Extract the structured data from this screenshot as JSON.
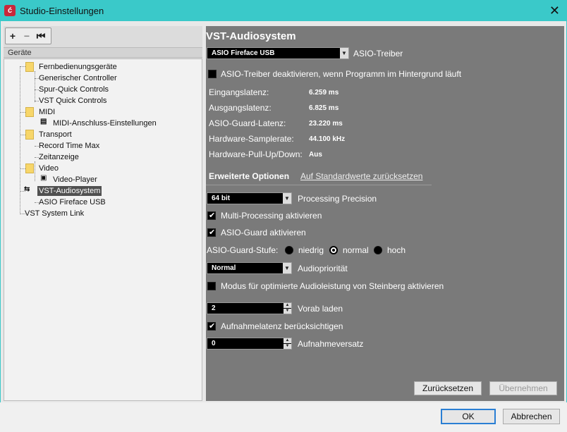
{
  "window": {
    "title": "Studio-Einstellungen",
    "close_glyph": "✕",
    "app_icon_glyph": "ć"
  },
  "left": {
    "toolbar": {
      "add": "+",
      "remove": "−",
      "reset": "⏮"
    },
    "header": "Geräte",
    "tree": [
      {
        "label": "Fernbedienungsgeräte",
        "type": "folder"
      },
      {
        "label": "Generischer Controller",
        "type": "item"
      },
      {
        "label": "Spur-Quick Controls",
        "type": "item"
      },
      {
        "label": "VST Quick Controls",
        "type": "item"
      },
      {
        "label": "MIDI",
        "type": "folder"
      },
      {
        "label": "MIDI-Anschluss-Einstellungen",
        "type": "item"
      },
      {
        "label": "Transport",
        "type": "folder"
      },
      {
        "label": "Record Time Max",
        "type": "item"
      },
      {
        "label": "Zeitanzeige",
        "type": "item"
      },
      {
        "label": "Video",
        "type": "folder"
      },
      {
        "label": "Video-Player",
        "type": "item"
      },
      {
        "label": "VST-Audiosystem",
        "type": "device",
        "selected": true
      },
      {
        "label": "ASIO Fireface USB",
        "type": "item"
      },
      {
        "label": "VST System Link",
        "type": "item"
      }
    ]
  },
  "right": {
    "title": "VST-Audiosystem",
    "driver": {
      "value": "ASIO Fireface USB",
      "label": "ASIO-Treiber"
    },
    "deactivate": {
      "label": "ASIO-Treiber deaktivieren, wenn Programm im Hintergrund läuft",
      "checked": false
    },
    "info": [
      {
        "label": "Eingangslatenz:",
        "value": "6.259 ms"
      },
      {
        "label": "Ausgangslatenz:",
        "value": "6.825 ms"
      },
      {
        "label": "ASIO-Guard-Latenz:",
        "value": "23.220 ms"
      },
      {
        "label": "Hardware-Samplerate:",
        "value": "44.100 kHz"
      },
      {
        "label": "Hardware-Pull-Up/Down:",
        "value": "Aus"
      }
    ],
    "tabs": {
      "active": "Erweiterte Optionen",
      "link": "Auf Standardwerte zurücksetzen"
    },
    "precision": {
      "value": "64 bit",
      "label": "Processing Precision"
    },
    "multiprocessing": {
      "label": "Multi-Processing aktivieren",
      "checked": true
    },
    "asioguard": {
      "label": "ASIO-Guard aktivieren",
      "checked": true
    },
    "guard_level": {
      "label": "ASIO-Guard-Stufe:",
      "options": [
        "niedrig",
        "normal",
        "hoch"
      ],
      "selected": "normal"
    },
    "priority": {
      "value": "Normal",
      "label": "Audiopriorität"
    },
    "steinberg_mode": {
      "label": "Modus für optimierte Audioleistung von Steinberg aktivieren",
      "checked": false
    },
    "preload": {
      "value": "2",
      "label": "Vorab laden"
    },
    "rec_latency": {
      "label": "Aufnahmelatenz berücksichtigen",
      "checked": true
    },
    "rec_offset": {
      "value": "0",
      "label": "Aufnahmeversatz"
    },
    "buttons": {
      "reset": "Zurücksetzen",
      "apply": "Übernehmen"
    }
  },
  "footer": {
    "ok": "OK",
    "cancel": "Abbrechen"
  },
  "colors": {
    "titlebar": "#3ac9c9",
    "panel": "#7a7a7a",
    "selected": "#505050",
    "folder": "#f7d66a"
  }
}
